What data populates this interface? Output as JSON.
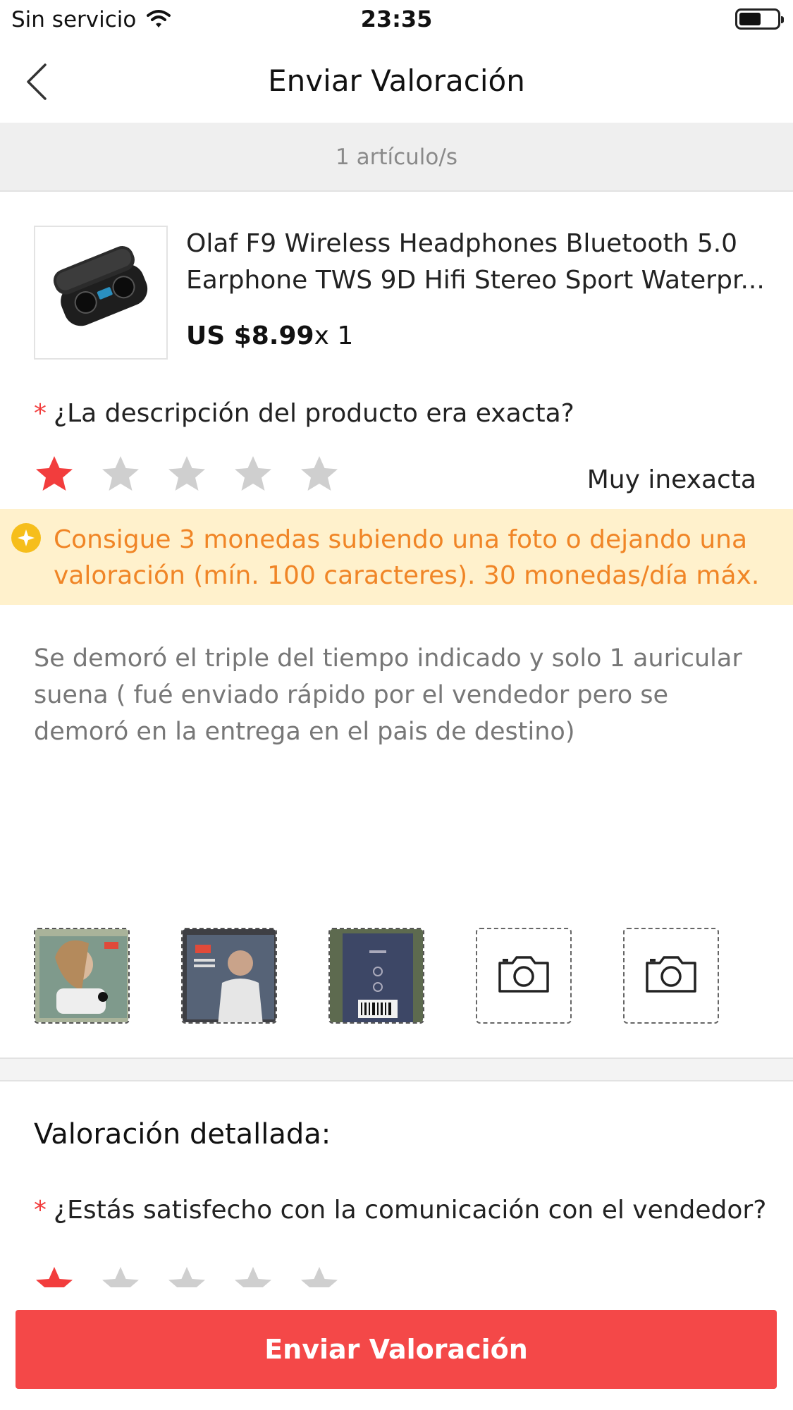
{
  "status_bar": {
    "carrier": "Sin servicio",
    "time": "23:35",
    "wifi_icon": "wifi-icon",
    "battery_icon": "battery-icon"
  },
  "nav": {
    "back_icon": "chevron-left-icon",
    "title": "Enviar Valoración"
  },
  "items_count": "1 artículo/s",
  "product": {
    "title": "Olaf F9 Wireless Headphones Bluetooth 5.0 Earphone TWS 9D Hifi Stereo Sport Waterpr...",
    "price": "US $8.99",
    "quantity": "x 1"
  },
  "question_1": {
    "required_mark": "*",
    "text": "¿La descripción del producto era exacta?",
    "rating": 1,
    "max_rating": 5,
    "rating_label": "Muy inexacta"
  },
  "banner": {
    "text": "Consigue 3 monedas subiendo una foto o dejando una valoración (mín. 100 caracteres). 30 monedas/día máx."
  },
  "review": {
    "text": "Se demoró el triple del tiempo indicado y solo 1 auricular suena ( fué enviado rápido por el vendedor pero se demoró en la entrega en el pais de destino)"
  },
  "photos": {
    "uploaded": [
      "photo-1",
      "photo-2",
      "photo-3"
    ],
    "add_slots": 2
  },
  "detailed": {
    "title": "Valoración detallada:",
    "question_2": {
      "required_mark": "*",
      "text": "¿Estás satisfecho con la comunicación con el vendedor?",
      "rating": 1
    }
  },
  "submit_label": "Enviar Valoración",
  "colors": {
    "accent": "#f44848",
    "star_active": "#f23d3d",
    "star_inactive": "#cfcfcf",
    "banner_bg": "#fff1cc",
    "banner_text": "#f08526"
  }
}
